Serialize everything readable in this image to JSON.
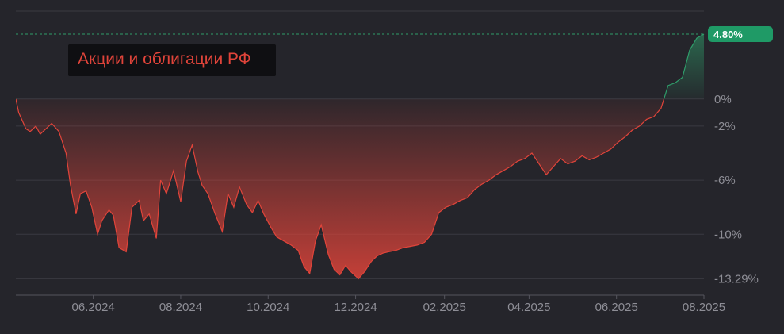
{
  "chart_data": {
    "type": "area",
    "title": "Акции и облигации РФ",
    "y_unit": "%",
    "ylim": [
      -14.5,
      6.5
    ],
    "xlim": [
      "2024-04-08",
      "2025-08-01"
    ],
    "y_ticks": [
      {
        "value": 0,
        "label": "0%"
      },
      {
        "value": -2,
        "label": "-2%"
      },
      {
        "value": -6,
        "label": "-6%"
      },
      {
        "value": -10,
        "label": "-10%"
      },
      {
        "value": -13.29,
        "label": "-13.29%"
      }
    ],
    "x_ticks": [
      {
        "date": "2024-06-01",
        "label": "06.2024"
      },
      {
        "date": "2024-08-01",
        "label": "08.2024"
      },
      {
        "date": "2024-10-01",
        "label": "10.2024"
      },
      {
        "date": "2024-12-01",
        "label": "12.2024"
      },
      {
        "date": "2025-02-01",
        "label": "02.2025"
      },
      {
        "date": "2025-04-01",
        "label": "04.2025"
      },
      {
        "date": "2025-06-01",
        "label": "06.2025"
      },
      {
        "date": "2025-08-01",
        "label": "08.2025"
      }
    ],
    "last_value_label": "4.80%",
    "max_value": 4.8,
    "min_value": -13.29,
    "colors": {
      "negative": "#e0443a",
      "positive": "#2f9d6a",
      "badge": "#1f9a66",
      "title": "#e0443a"
    },
    "series": [
      {
        "x": [
          "2024-04-08",
          "2024-04-10",
          "2024-04-15",
          "2024-04-18",
          "2024-04-22",
          "2024-04-25",
          "2024-04-29",
          "2024-05-03",
          "2024-05-08",
          "2024-05-13",
          "2024-05-16",
          "2024-05-20",
          "2024-05-23",
          "2024-05-27",
          "2024-05-31",
          "2024-06-04",
          "2024-06-07",
          "2024-06-12",
          "2024-06-15",
          "2024-06-19",
          "2024-06-24",
          "2024-06-28",
          "2024-07-03",
          "2024-07-06",
          "2024-07-10",
          "2024-07-15",
          "2024-07-18",
          "2024-07-22",
          "2024-07-27",
          "2024-08-01",
          "2024-08-05",
          "2024-08-09",
          "2024-08-13",
          "2024-08-16",
          "2024-08-20",
          "2024-08-25",
          "2024-08-30",
          "2024-09-03",
          "2024-09-07",
          "2024-09-11",
          "2024-09-16",
          "2024-09-20",
          "2024-09-24",
          "2024-09-28",
          "2024-10-03",
          "2024-10-07",
          "2024-10-12",
          "2024-10-17",
          "2024-10-22",
          "2024-10-26",
          "2024-10-30",
          "2024-11-03",
          "2024-11-07",
          "2024-11-12",
          "2024-11-16",
          "2024-11-20",
          "2024-11-24",
          "2024-11-28",
          "2024-12-03",
          "2024-12-07",
          "2024-12-12",
          "2024-12-16",
          "2024-12-20",
          "2024-12-24",
          "2024-12-29",
          "2025-01-03",
          "2025-01-08",
          "2025-01-13",
          "2025-01-18",
          "2025-01-23",
          "2025-01-28",
          "2025-02-02",
          "2025-02-07",
          "2025-02-12",
          "2025-02-17",
          "2025-02-22",
          "2025-02-27",
          "2025-03-04",
          "2025-03-09",
          "2025-03-14",
          "2025-03-19",
          "2025-03-24",
          "2025-03-29",
          "2025-04-03",
          "2025-04-08",
          "2025-04-13",
          "2025-04-18",
          "2025-04-23",
          "2025-04-28",
          "2025-05-03",
          "2025-05-08",
          "2025-05-13",
          "2025-05-18",
          "2025-05-23",
          "2025-05-28",
          "2025-06-02",
          "2025-06-07",
          "2025-06-12",
          "2025-06-17",
          "2025-06-22",
          "2025-06-27",
          "2025-07-02",
          "2025-07-07",
          "2025-07-12",
          "2025-07-17",
          "2025-07-22",
          "2025-07-27",
          "2025-08-01"
        ],
        "y": [
          0.0,
          -1.0,
          -2.2,
          -2.4,
          -2.0,
          -2.6,
          -2.2,
          -1.8,
          -2.4,
          -4.0,
          -6.3,
          -8.5,
          -7.0,
          -6.8,
          -8.0,
          -10.0,
          -9.0,
          -8.2,
          -8.6,
          -11.0,
          -11.3,
          -8.0,
          -7.5,
          -9.0,
          -8.5,
          -10.3,
          -6.0,
          -7.0,
          -5.3,
          -7.6,
          -4.6,
          -3.4,
          -5.4,
          -6.4,
          -7.0,
          -8.5,
          -9.8,
          -7.0,
          -8.0,
          -6.5,
          -7.8,
          -8.4,
          -7.5,
          -8.5,
          -9.5,
          -10.2,
          -10.5,
          -10.8,
          -11.2,
          -12.4,
          -12.9,
          -10.5,
          -9.3,
          -11.5,
          -12.6,
          -13.0,
          -12.3,
          -12.8,
          -13.29,
          -12.8,
          -12.0,
          -11.6,
          -11.4,
          -11.3,
          -11.2,
          -11.0,
          -10.9,
          -10.8,
          -10.6,
          -10.0,
          -8.4,
          -8.0,
          -7.8,
          -7.5,
          -7.3,
          -6.7,
          -6.3,
          -6.0,
          -5.6,
          -5.3,
          -5.0,
          -4.6,
          -4.4,
          -4.0,
          -4.8,
          -5.6,
          -5.0,
          -4.4,
          -4.8,
          -4.6,
          -4.2,
          -4.5,
          -4.3,
          -4.0,
          -3.7,
          -3.2,
          -2.8,
          -2.3,
          -2.0,
          -1.5,
          -1.3,
          -0.7,
          1.0,
          1.2,
          1.6,
          3.6,
          4.5,
          4.8
        ]
      }
    ]
  }
}
